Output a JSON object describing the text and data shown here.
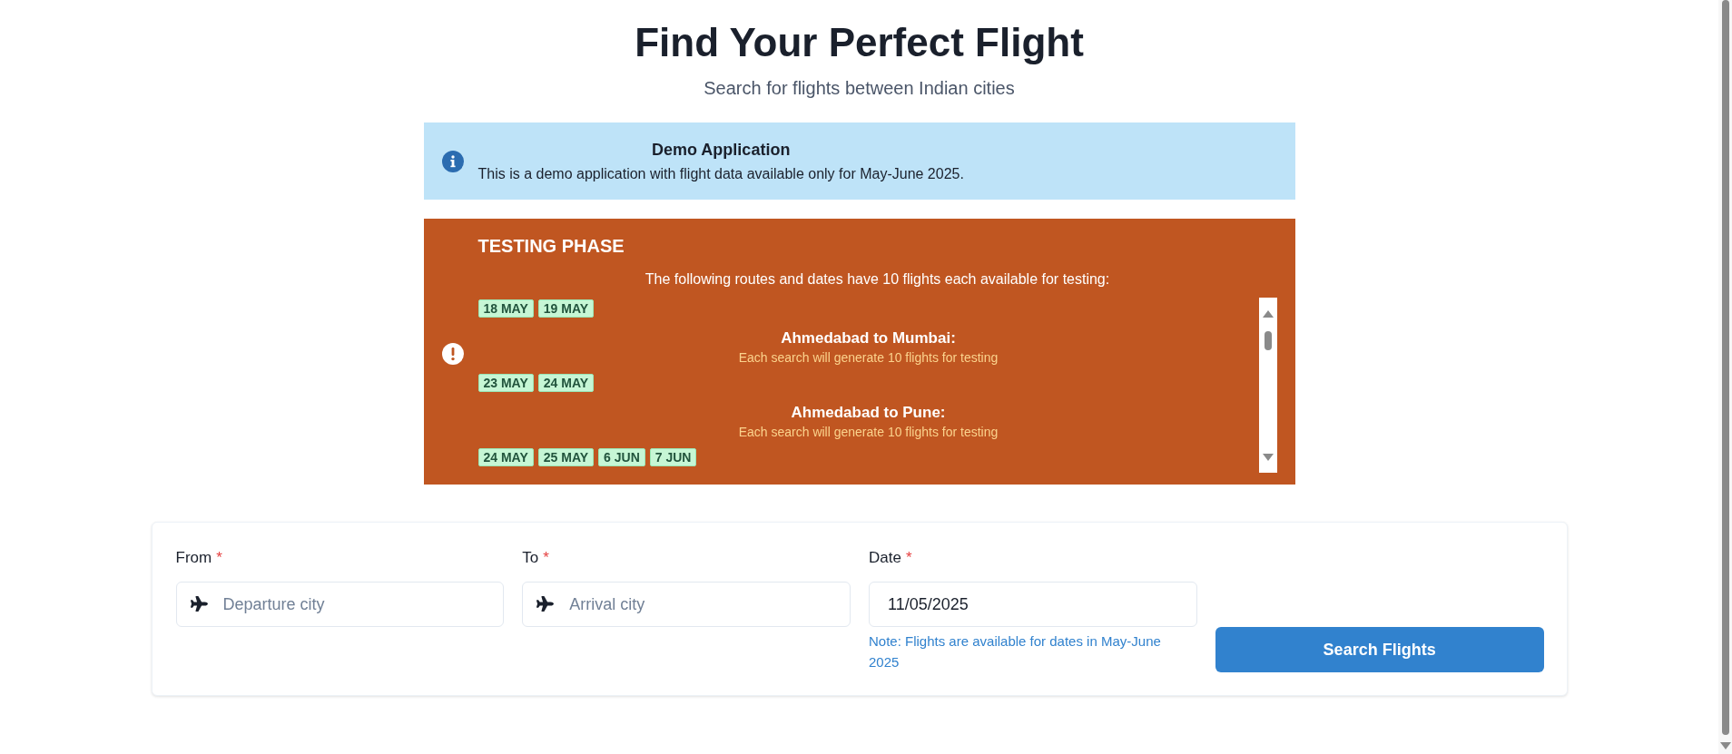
{
  "header": {
    "title": "Find Your Perfect Flight",
    "subtitle": "Search for flights between Indian cities"
  },
  "demo_notice": {
    "title": "Demo Application",
    "message": "This is a demo application with flight data available only for May-June 2025."
  },
  "testing_notice": {
    "title": "TESTING PHASE",
    "intro": "The following routes and dates have 10 flights each available for testing:",
    "routes": [
      {
        "dates": [
          "18 MAY",
          "19 MAY"
        ]
      },
      {
        "name": "Ahmedabad to Mumbai:",
        "note": "Each search will generate 10 flights for testing",
        "dates": [
          "23 MAY",
          "24 MAY"
        ]
      },
      {
        "name": "Ahmedabad to Pune:",
        "note": "Each search will generate 10 flights for testing",
        "dates": [
          "24 MAY",
          "25 MAY",
          "6 JUN",
          "7 JUN"
        ]
      }
    ]
  },
  "search_form": {
    "fields": [
      {
        "kind": "city",
        "label": "From",
        "required_mark": "*",
        "placeholder": "Departure city"
      },
      {
        "kind": "city",
        "label": "To",
        "required_mark": "*",
        "placeholder": "Arrival city"
      },
      {
        "kind": "date",
        "label": "Date",
        "required_mark": "*",
        "value": "11/05/2025",
        "note": "Note: Flights are available for dates in May-June 2025"
      }
    ],
    "button": "Search Flights"
  }
}
